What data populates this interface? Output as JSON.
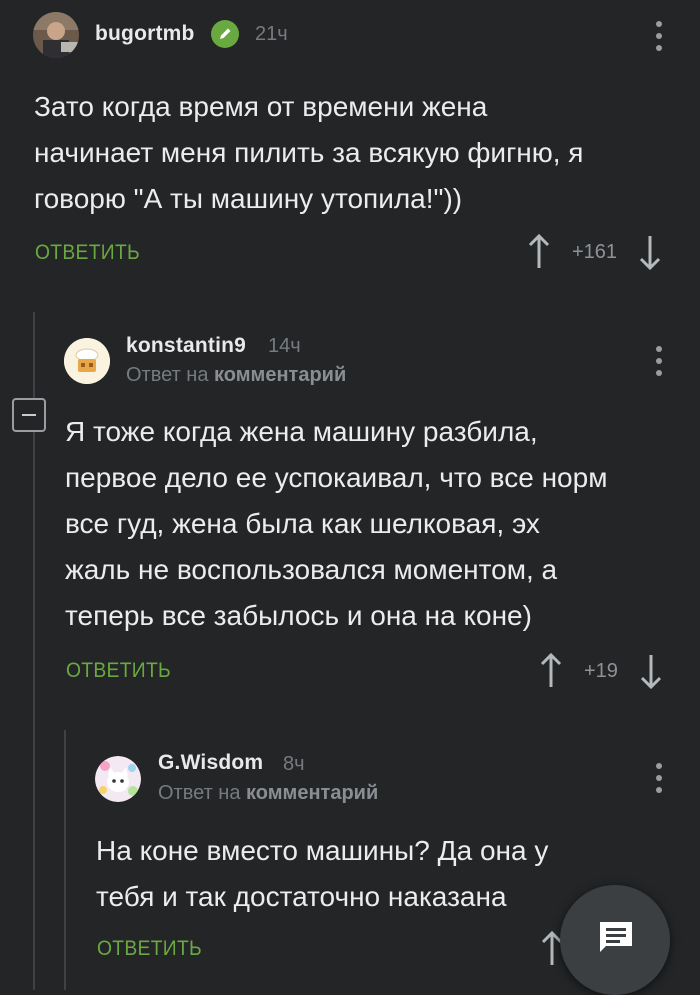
{
  "comments": [
    {
      "username": "bugortmb",
      "verified": true,
      "time": "21ч",
      "text_lines": [
        "Зато когда время от времени жена",
        "начинает меня пилить за всякую фигню, я",
        "говорю \"А ты машину утопила!\"))"
      ],
      "reply_label": "ОТВЕТИТЬ",
      "votes": "+161"
    },
    {
      "username": "konstantin9",
      "time": "14ч",
      "reply_prefix": "Ответ на",
      "reply_target": "комментарий",
      "text_lines": [
        "Я тоже когда жена машину разбила,",
        "первое дело ее успокаивал, что все норм",
        "все гуд, жена была как шелковая, эх",
        "жаль не воспользовался моментом, а",
        "теперь все забылось и она на коне)"
      ],
      "reply_label": "ОТВЕТИТЬ",
      "votes": "+19"
    },
    {
      "username": "G.Wisdom",
      "time": "8ч",
      "reply_prefix": "Ответ на",
      "reply_target": "комментарий",
      "text_lines": [
        "На коне вместо машины? Да она у",
        "тебя и так достаточно наказана"
      ],
      "reply_label": "ОТВЕТИТЬ"
    }
  ],
  "icons": {
    "upvote": "arrow-up-icon",
    "downvote": "arrow-down-icon",
    "more": "kebab-menu-icon",
    "collapse": "collapse-thread-icon",
    "verified": "verified-pencil-icon",
    "fab": "comment-icon"
  },
  "colors": {
    "background": "#232527",
    "accent_green": "#6aa840",
    "muted": "#777b7f"
  }
}
